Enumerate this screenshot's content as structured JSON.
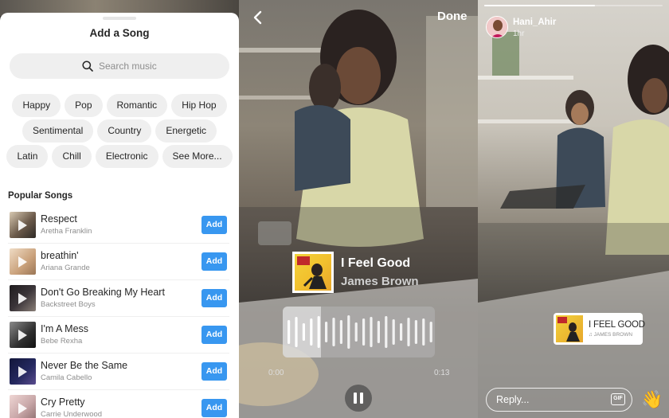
{
  "picker": {
    "title": "Add a Song",
    "search_placeholder": "Search music",
    "genres": [
      [
        "Happy",
        "Pop",
        "Romantic",
        "Hip Hop"
      ],
      [
        "Sentimental",
        "Country",
        "Energetic"
      ],
      [
        "Latin",
        "Chill",
        "Electronic",
        "See More..."
      ]
    ],
    "popular_title": "Popular Songs",
    "add_label": "Add",
    "songs": [
      {
        "title": "Respect",
        "artist": "Aretha Franklin",
        "cover_color": "#6b5a4a"
      },
      {
        "title": "breathin'",
        "artist": "Ariana Grande",
        "cover_color": "#c9a07a"
      },
      {
        "title": "Don't Go Breaking My Heart",
        "artist": "Backstreet Boys",
        "cover_color": "#3a3438"
      },
      {
        "title": "I'm A Mess",
        "artist": "Bebe Rexha",
        "cover_color": "#2e2e2e"
      },
      {
        "title": "Never Be the Same",
        "artist": "Camila Cabello",
        "cover_color": "#24285e"
      },
      {
        "title": "Cry Pretty",
        "artist": "Carrie Underwood",
        "cover_color": "#c8a7a8"
      }
    ]
  },
  "preview": {
    "done_label": "Done",
    "song_title": "I Feel Good",
    "artist": "James Brown",
    "time_start": "0:00",
    "time_end": "0:13",
    "played_fraction": 0.25
  },
  "story": {
    "user_name": "Hani_Ahir",
    "post_time": "1hr",
    "progress_fraction": 0.62,
    "sticker_song": "I FEEL GOOD",
    "sticker_artist": "♫ JAMES BROWN",
    "reply_placeholder": "Reply...",
    "gif_label": "GIF",
    "wave_emoji": "👋"
  },
  "colors": {
    "accent_blue": "#3897f0",
    "chip_bg": "#efefef",
    "text_dark": "#262626",
    "text_muted": "#8e8e8e"
  }
}
